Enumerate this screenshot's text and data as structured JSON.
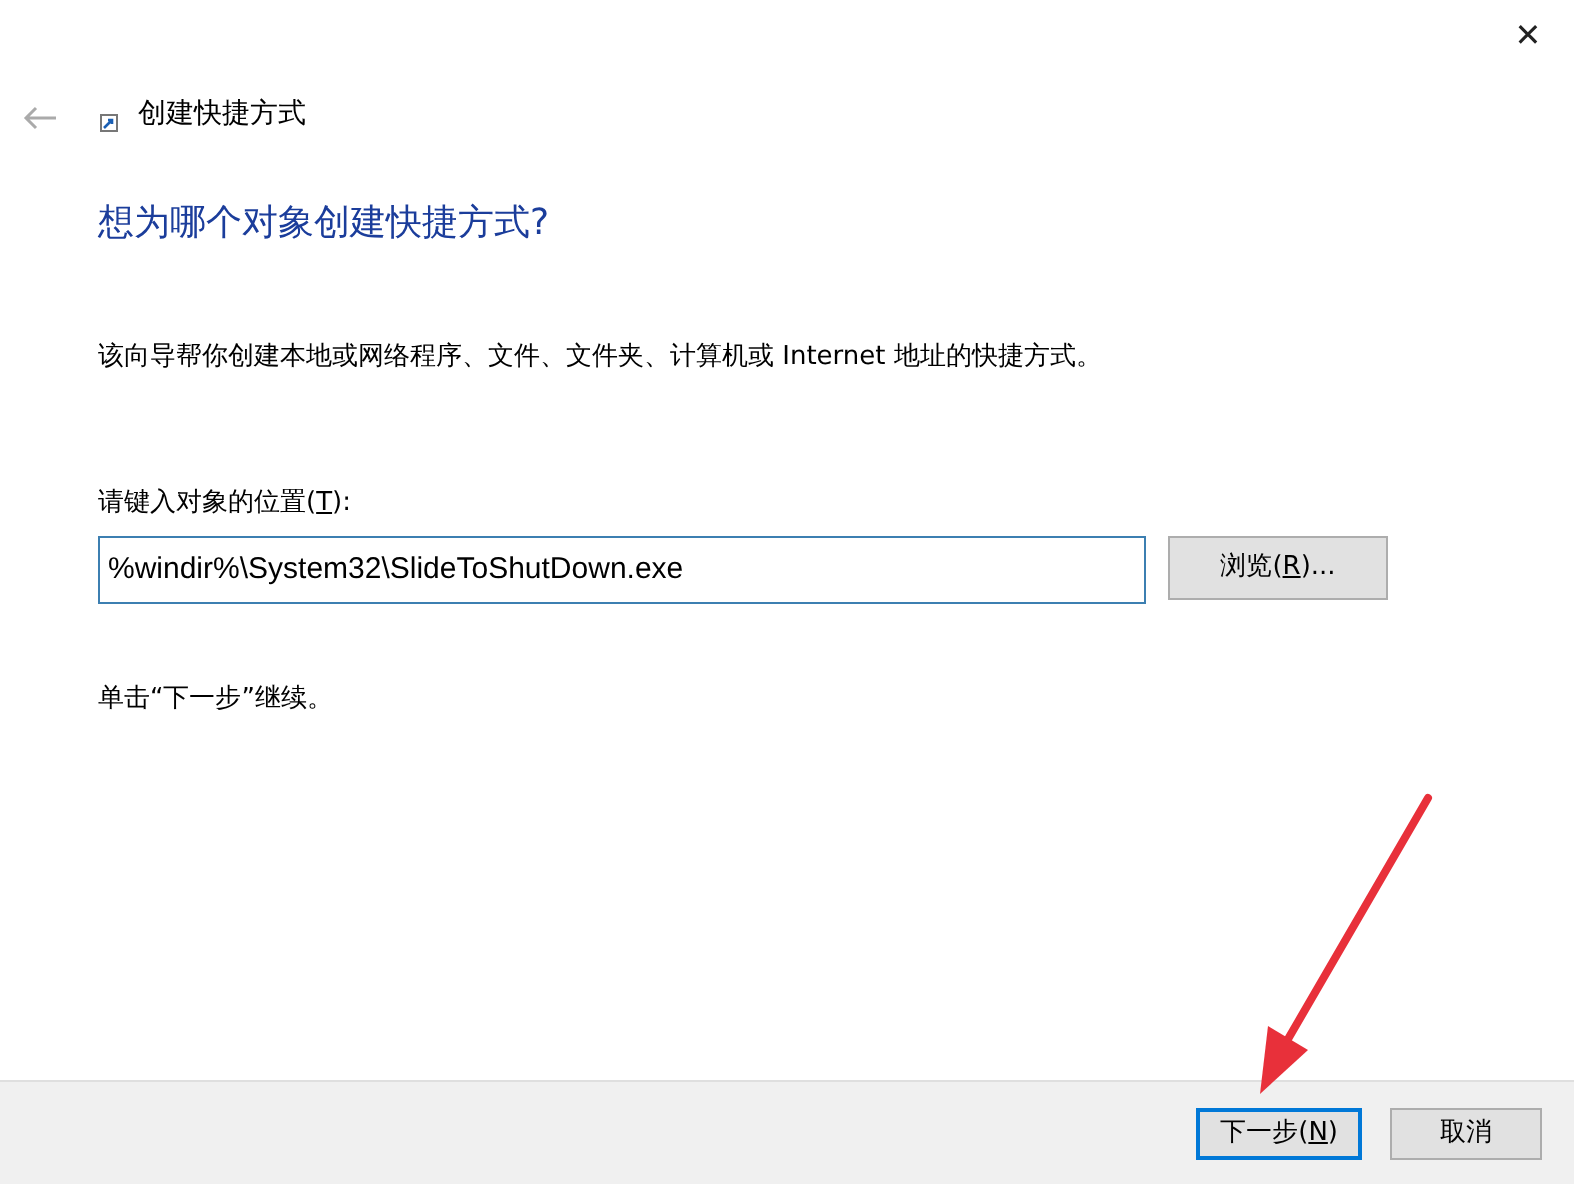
{
  "window": {
    "close_glyph": "✕",
    "back_disabled": true,
    "title": "创建快捷方式"
  },
  "heading": "想为哪个对象创建快捷方式?",
  "description": "该向导帮你创建本地或网络程序、文件、文件夹、计算机或 Internet 地址的快捷方式。",
  "location": {
    "label": {
      "before": "请键入对象的位置(",
      "key": "T",
      "after": "):"
    },
    "value": "%windir%\\System32\\SlideToShutDown.exe",
    "browse": {
      "before": "浏览(",
      "key": "R",
      "after": ")..."
    }
  },
  "hint": "单击“下一步”继续。",
  "buttons": [
    {
      "before": "下一步(",
      "key": "N",
      "after": ")",
      "default": true
    },
    {
      "before": "取消",
      "default": false
    }
  ],
  "annotation": {
    "kind": "arrow"
  }
}
